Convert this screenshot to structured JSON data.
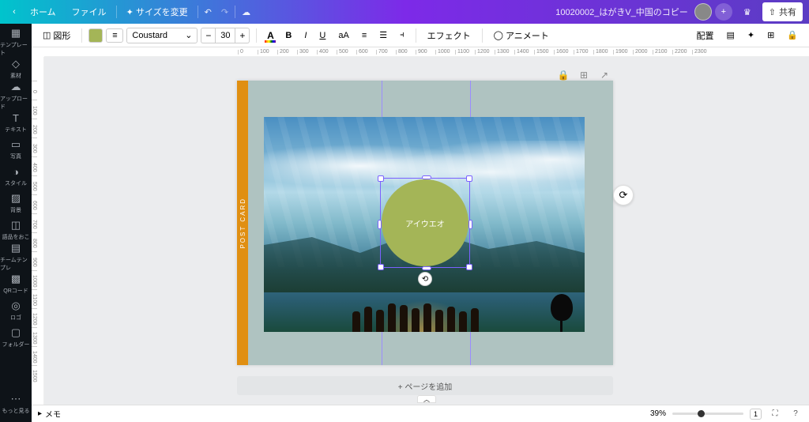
{
  "topbar": {
    "home": "ホーム",
    "file": "ファイル",
    "resize": "サイズを変更",
    "doc_title": "10020002_はがきV_中国のコピー",
    "share": "共有"
  },
  "sidebar": {
    "items": [
      {
        "label": "テンプレート"
      },
      {
        "label": "素材"
      },
      {
        "label": "アップロード"
      },
      {
        "label": "テキスト"
      },
      {
        "label": "写真"
      },
      {
        "label": "スタイル"
      },
      {
        "label": "背景"
      },
      {
        "label": "語品をおこ"
      },
      {
        "label": "チームテンプレ"
      },
      {
        "label": "QRコード"
      },
      {
        "label": "ロゴ"
      },
      {
        "label": "フォルダー"
      }
    ],
    "more": "もっと見る"
  },
  "toolbar": {
    "shape": "図形",
    "font": "Coustard",
    "size": "30",
    "effect": "エフェクト",
    "animate": "アニメート",
    "position": "配置"
  },
  "ruler_h": [
    "0",
    "100",
    "200",
    "300",
    "400",
    "500",
    "600",
    "700",
    "800",
    "900",
    "1000",
    "1100",
    "1200",
    "1300",
    "1400",
    "1500",
    "1600",
    "1700",
    "1800",
    "1900",
    "2000",
    "2100",
    "2200",
    "2300"
  ],
  "ruler_v": [
    "0",
    "100",
    "200",
    "300",
    "400",
    "500",
    "600",
    "700",
    "800",
    "900",
    "1000",
    "1100",
    "1200",
    "1300",
    "1400",
    "1500"
  ],
  "canvas": {
    "strip_text": "POST CARD",
    "circle_text": "アイウエオ",
    "add_page": "+ ページを追加"
  },
  "bottombar": {
    "notes": "メモ",
    "zoom": "39%",
    "page": "1"
  }
}
